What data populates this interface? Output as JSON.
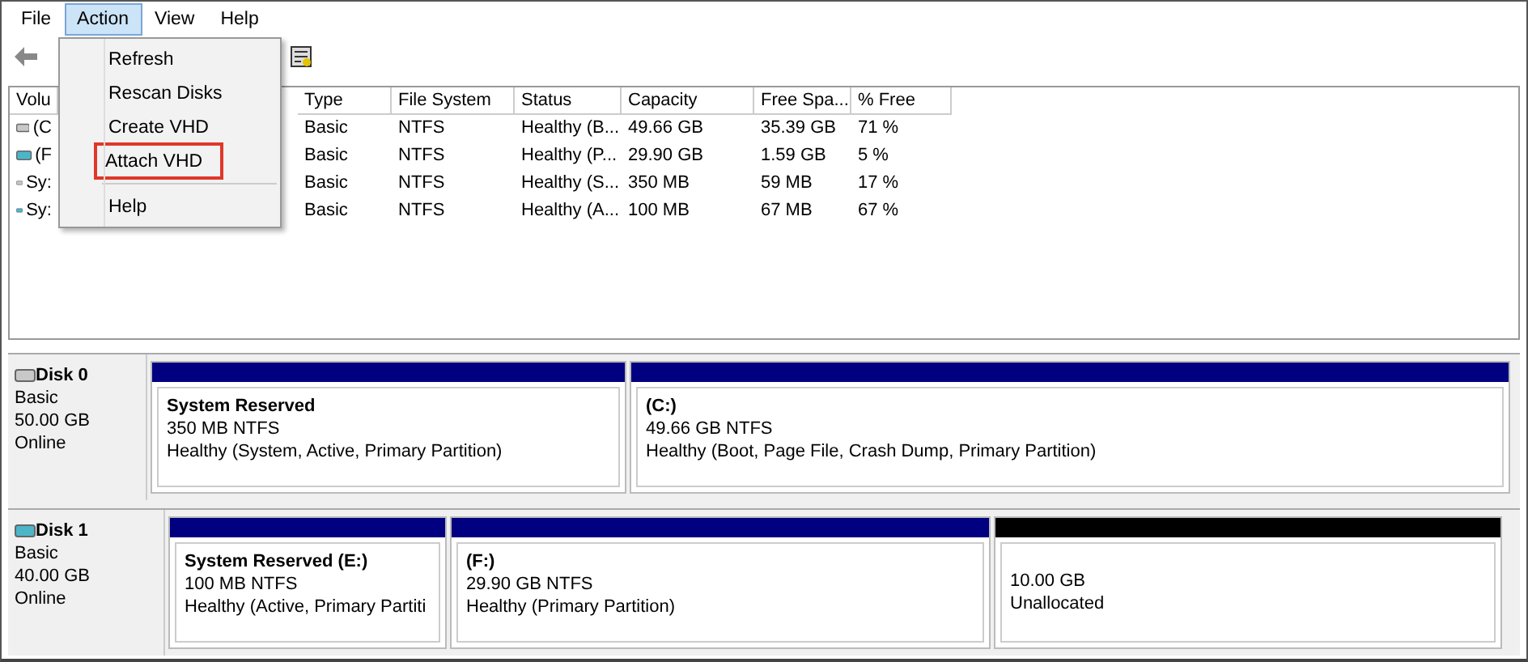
{
  "menu_bar": [
    {
      "label": "File",
      "selected": false
    },
    {
      "label": "Action",
      "selected": true
    },
    {
      "label": "View",
      "selected": false
    },
    {
      "label": "Help",
      "selected": false
    }
  ],
  "action_menu": [
    {
      "kind": "item",
      "label": "Refresh",
      "highlighted": false
    },
    {
      "kind": "item",
      "label": "Rescan Disks",
      "highlighted": false
    },
    {
      "kind": "item",
      "label": "Create VHD",
      "highlighted": false
    },
    {
      "kind": "item",
      "label": "Attach VHD",
      "highlighted": true
    },
    {
      "kind": "separator"
    },
    {
      "kind": "item",
      "label": "Help",
      "highlighted": false
    }
  ],
  "volume_table": {
    "columns": [
      "Volu",
      "Type",
      "File System",
      "Status",
      "Capacity",
      "Free Spa...",
      "% Free"
    ],
    "rows": [
      {
        "kind": "system",
        "cells": [
          "(C",
          "Basic",
          "NTFS",
          "Healthy (B...",
          "49.66 GB",
          "35.39 GB",
          "71 %"
        ]
      },
      {
        "kind": "virtual",
        "cells": [
          "(F",
          "Basic",
          "NTFS",
          "Healthy (P...",
          "29.90 GB",
          "1.59 GB",
          "5 %"
        ]
      },
      {
        "kind": "system",
        "cells": [
          "Sy:",
          "Basic",
          "NTFS",
          "Healthy (S...",
          "350 MB",
          "59 MB",
          "17 %"
        ]
      },
      {
        "kind": "virtual",
        "cells": [
          "Sy:",
          "Basic",
          "NTFS",
          "Healthy (A...",
          "100 MB",
          "67 MB",
          "67 %"
        ]
      }
    ]
  },
  "disks": [
    {
      "name": "Disk 0",
      "kind": "system",
      "type": "Basic",
      "size": "50.00 GB",
      "status": "Online",
      "partitions": [
        {
          "kind": "primary",
          "name": "System Reserved",
          "size": "350 MB NTFS",
          "status": "Healthy (System, Active, Primary Partition)"
        },
        {
          "kind": "primary",
          "name": "(C:)",
          "size": "49.66 GB NTFS",
          "status": "Healthy (Boot, Page File, Crash Dump, Primary Partition)"
        }
      ]
    },
    {
      "name": "Disk 1",
      "kind": "virtual",
      "type": "Basic",
      "size": "40.00 GB",
      "status": "Online",
      "partitions": [
        {
          "kind": "primary",
          "name": "System Reserved  (E:)",
          "size": "100 MB NTFS",
          "status": "Healthy (Active, Primary Partiti"
        },
        {
          "kind": "primary",
          "name": "(F:)",
          "size": "29.90 GB NTFS",
          "status": "Healthy (Primary Partition)"
        },
        {
          "kind": "unallocated",
          "size": "10.00 GB",
          "status": "Unallocated"
        }
      ]
    }
  ]
}
